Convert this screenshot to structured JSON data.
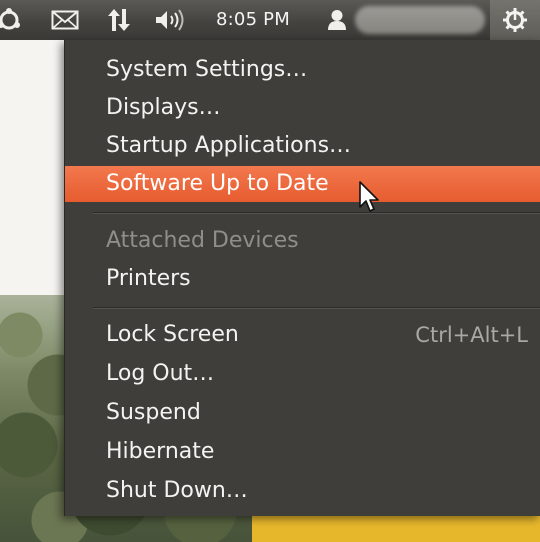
{
  "panel": {
    "clock": "8:05 PM",
    "icons": [
      "ubuntu-logo-icon",
      "mail-icon",
      "network-icon",
      "volume-icon",
      "user-icon",
      "power-gear-icon"
    ]
  },
  "menu": {
    "items": [
      {
        "label": "System Settings…",
        "state": "normal"
      },
      {
        "label": "Displays…",
        "state": "normal"
      },
      {
        "label": "Startup Applications…",
        "state": "normal"
      },
      {
        "label": "Software Up to Date",
        "state": "highlighted"
      },
      {
        "label": "Attached Devices",
        "state": "disabled"
      },
      {
        "label": "Printers",
        "state": "normal"
      },
      {
        "label": "Lock Screen",
        "accelerator": "Ctrl+Alt+L",
        "state": "normal"
      },
      {
        "label": "Log Out…",
        "state": "normal"
      },
      {
        "label": "Suspend",
        "state": "normal"
      },
      {
        "label": "Hibernate",
        "state": "normal"
      },
      {
        "label": "Shut Down…",
        "state": "normal"
      }
    ]
  },
  "colors": {
    "highlight": "#ef6a3c",
    "menu_background": "#3f3e3a",
    "panel_background": "#444340",
    "text": "#f4f3f1",
    "disabled_text": "#8f8e89"
  }
}
